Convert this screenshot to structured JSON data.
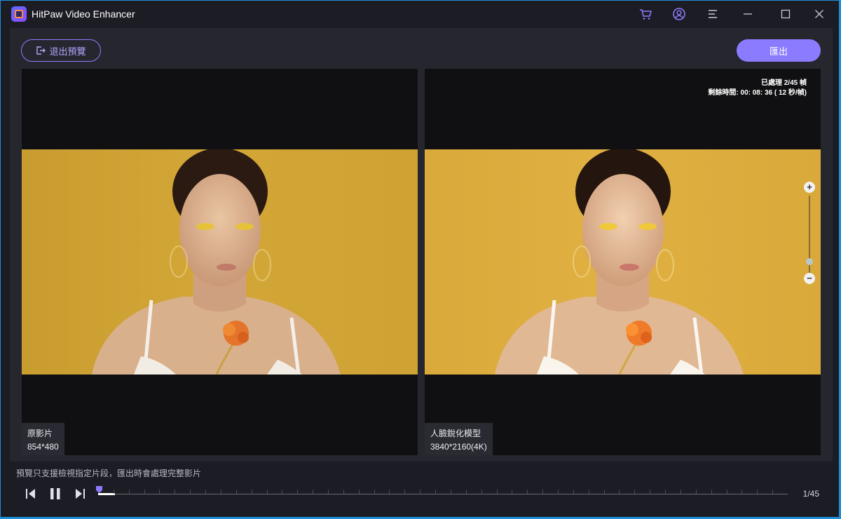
{
  "app": {
    "title": "HitPaw Video Enhancer",
    "icons": [
      "cart-icon",
      "account-icon",
      "menu-icon",
      "minimize-icon",
      "maximize-icon",
      "close-icon"
    ]
  },
  "toolbar": {
    "exit_preview_label": "退出預覽",
    "export_label": "匯出"
  },
  "left_panel": {
    "name": "原影片",
    "resolution": "854*480"
  },
  "right_panel": {
    "name": "人臉銳化模型",
    "resolution": "3840*2160(4K)",
    "processed": "已處理 2/45 幀",
    "remaining": "剩餘時間: 00: 08: 36 ( 12 秒/幀)"
  },
  "zoom": {
    "plus": "+",
    "minus": "−",
    "level": 0.15
  },
  "footer": {
    "hint": "預覽只支援檢視指定片段，匯出時會處理完整影片",
    "frame_counter": "1/45",
    "current_frame": 1,
    "total_frames": 45
  },
  "colors": {
    "accent": "#8b7bff",
    "background": "#1c1c24",
    "panel": "#26262f"
  }
}
